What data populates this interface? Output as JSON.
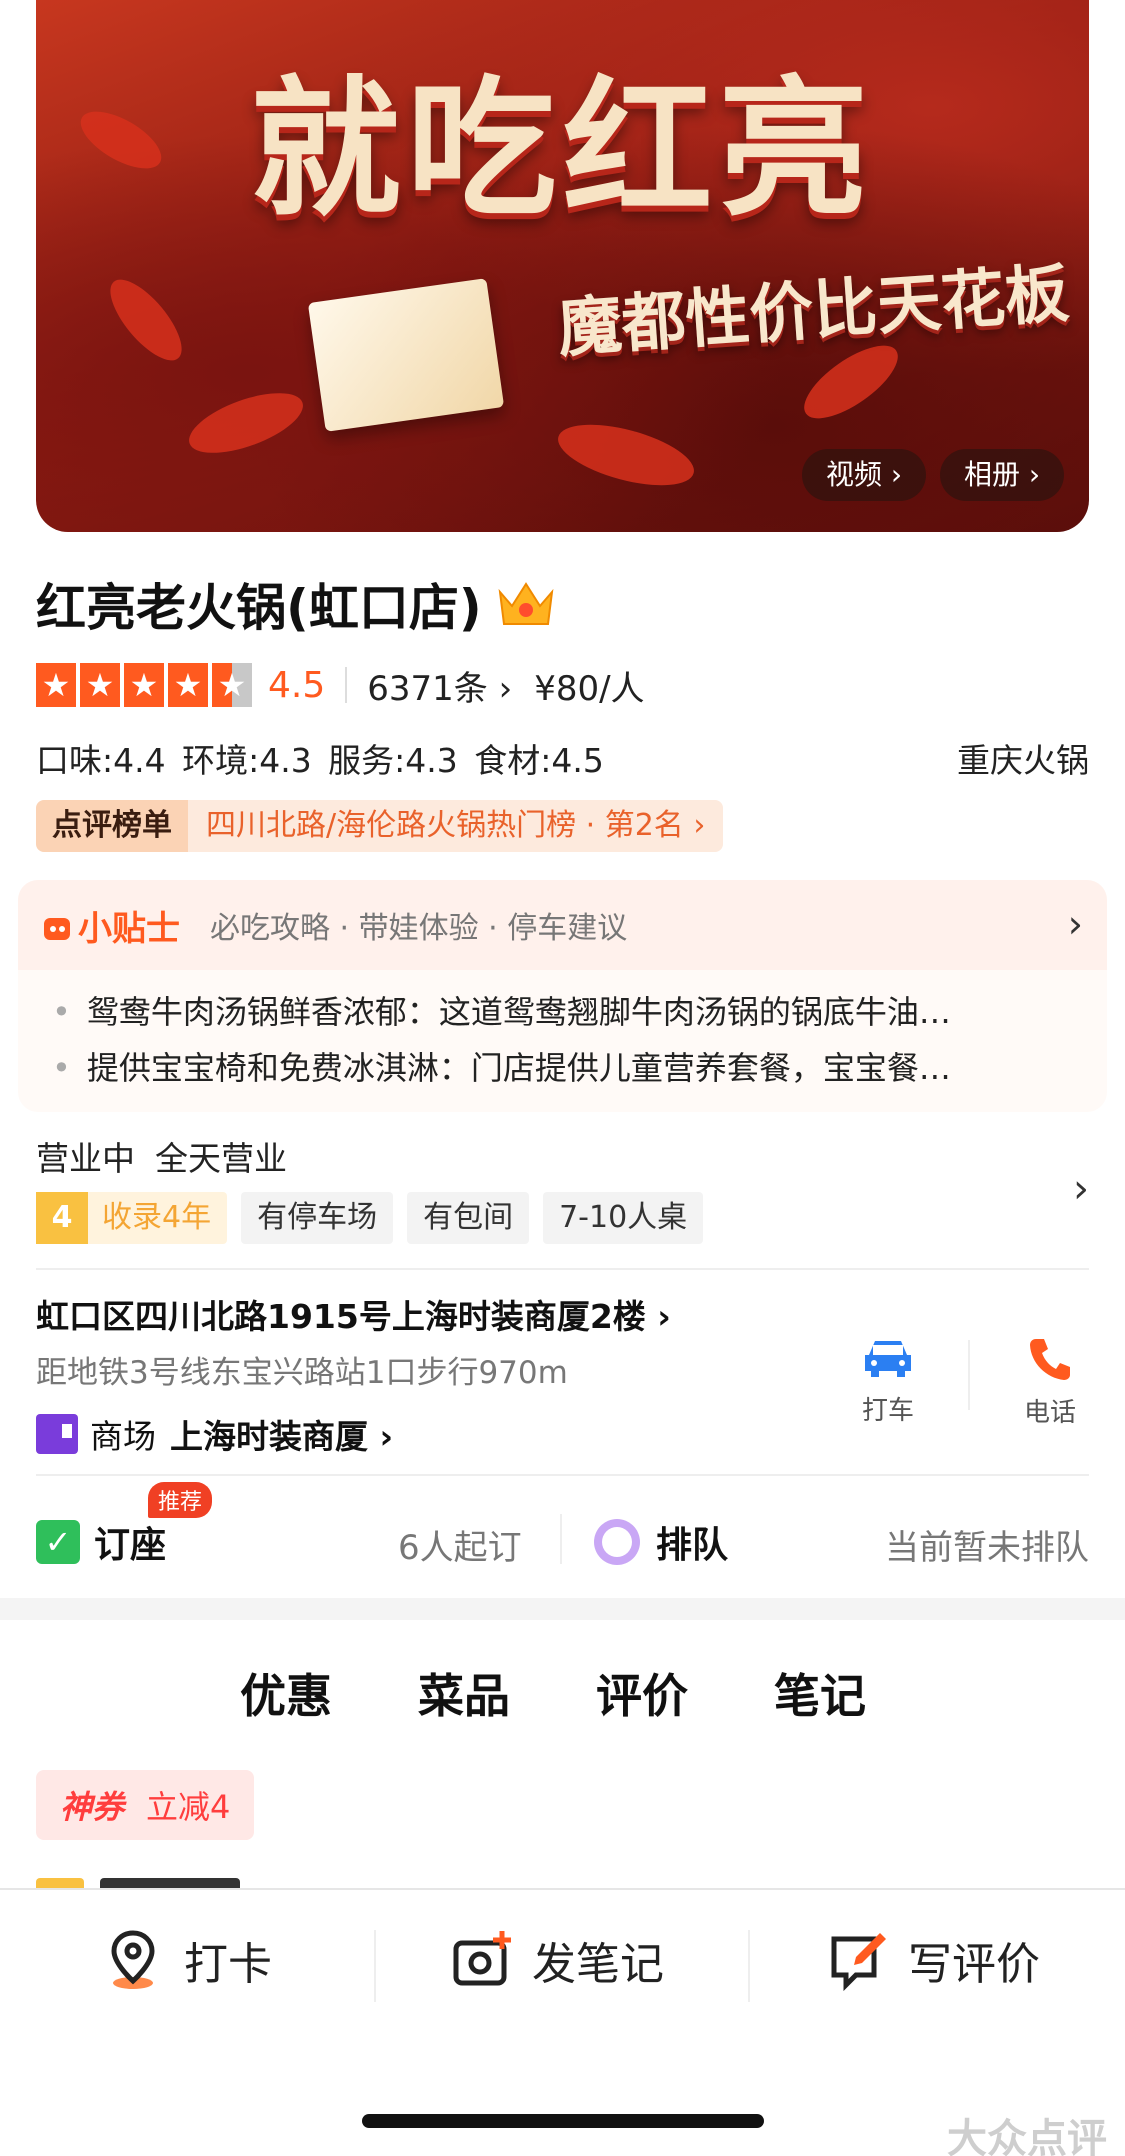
{
  "hero": {
    "title": "就吃红亮",
    "subtitle": "魔都性价比天花板",
    "video_label": "视频 ›",
    "album_label": "相册 ›"
  },
  "shop": {
    "name": "红亮老火锅(虹口店)",
    "rating": "4.5",
    "rating_stars": 4.5,
    "review_count": "6371条 ›",
    "price": "¥80/人",
    "sub_scores": "口味:4.4 环境:4.3 服务:4.3 食材:4.5",
    "category": "重庆火锅",
    "rank_tag": "点评榜单",
    "rank_text": "四川北路/海伦路火锅热门榜 · 第2名 ›"
  },
  "tips": {
    "logo": "小贴士",
    "categories": "必吃攻略 · 带娃体验 · 停车建议",
    "arrow": "›",
    "items": [
      "鸳鸯牛肉汤锅鲜香浓郁：这道鸳鸯翘脚牛肉汤锅的锅底牛油…",
      "提供宝宝椅和免费冰淇淋：门店提供儿童营养套餐，宝宝餐…"
    ]
  },
  "hours": {
    "status": "营业中",
    "time": "全天营业",
    "year_num": "4",
    "year_text": "收录4年",
    "badges": [
      "有停车场",
      "有包间",
      "7-10人桌"
    ],
    "arrow": "›"
  },
  "address": {
    "line": "虹口区四川北路1915号上海时装商厦2楼 ›",
    "metro": "距地铁3号线东宝兴路站1口步行970m",
    "mall_prefix": "商场",
    "mall_name": "上海时装商厦 ›",
    "taxi_label": "打车",
    "phone_label": "电话"
  },
  "booking": {
    "label": "订座",
    "recommend": "推荐",
    "min": "6人起订",
    "queue_label": "排队",
    "queue_status": "当前暂未排队"
  },
  "tabs": [
    "优惠",
    "菜品",
    "评价",
    "笔记"
  ],
  "coupon": {
    "tag": "神券",
    "text": "立减4"
  },
  "bottom_bar": {
    "checkin": "打卡",
    "note": "发笔记",
    "review": "写评价"
  },
  "watermark": "大众点评",
  "colors": {
    "accent": "#ff5a1f",
    "bg": "#ffffff"
  }
}
